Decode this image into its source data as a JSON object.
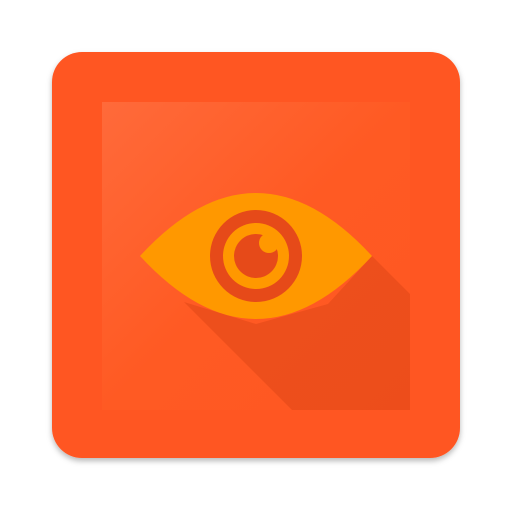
{
  "app_icon": {
    "icon_name": "eye-icon",
    "colors": {
      "tile": "#FF5722",
      "tile_shadow": "#BF360C",
      "inner_panel": "#FF5A23",
      "eye": "#FF9800",
      "eye_dark": "#E64A19",
      "long_shadow": "#D84315"
    }
  }
}
